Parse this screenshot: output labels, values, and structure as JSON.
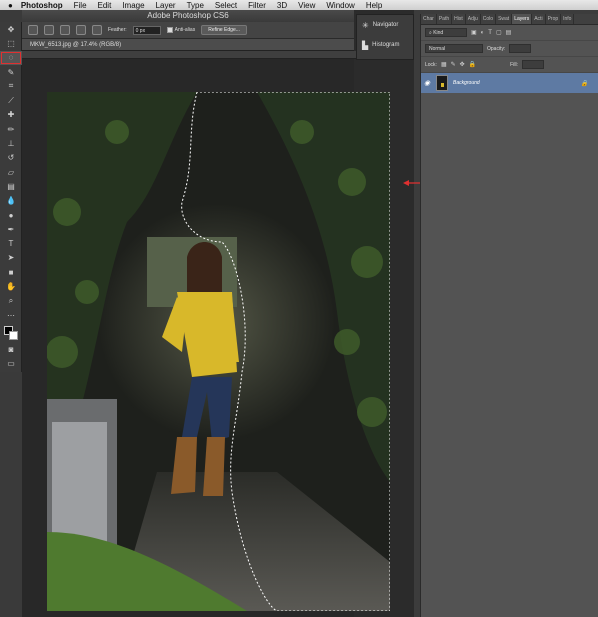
{
  "menubar": {
    "apple": "",
    "app": "Photoshop",
    "items": [
      "File",
      "Edit",
      "Image",
      "Layer",
      "Type",
      "Select",
      "Filter",
      "3D",
      "View",
      "Window",
      "Help"
    ]
  },
  "window": {
    "title": "Adobe Photoshop CS6"
  },
  "options": {
    "feather_label": "Feather:",
    "feather_value": "0 px",
    "antialias_label": "Anti-alias",
    "refine_label": "Refine Edge..."
  },
  "document": {
    "tab": "MKW_6513.jpg @ 17.4% (RGB/8)"
  },
  "mini_panels": [
    {
      "icon": "navigator-icon",
      "label": "Navigator"
    },
    {
      "icon": "histogram-icon",
      "label": "Histogram"
    }
  ],
  "panel_tabs": [
    "Char",
    "Path",
    "Hist",
    "Adju",
    "Colo",
    "Swat",
    "Layers",
    "Acti",
    "Prop",
    "Info"
  ],
  "layers_panel": {
    "kind_label": "Kind",
    "blend": "Normal",
    "opacity_label": "Opacity:",
    "lock_label": "Lock:",
    "fill_label": "Fill:",
    "layer_name": "Background"
  },
  "colors": {
    "accent": "#e03030",
    "layer_selected": "#5e7aa3",
    "shirt": "#d8b82a"
  }
}
